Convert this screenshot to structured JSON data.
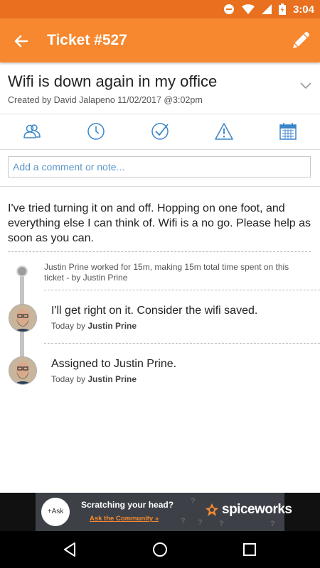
{
  "status_bar": {
    "time": "3:04",
    "icons": [
      "do-not-disturb-icon",
      "wifi-icon",
      "signal-icon",
      "battery-icon"
    ]
  },
  "app_bar": {
    "title": "Ticket #527",
    "back_icon": "back-arrow-icon",
    "edit_icon": "pencil-icon",
    "color": "#f7882f"
  },
  "ticket": {
    "title": "Wifi is down again in my office",
    "meta": "Created by David Jalapeno 11/02/2017 @3:02pm",
    "description": "I've tried turning it on and off. Hopping on one foot, and everything else I can think of. Wifi is a no go. Please help as soon as you can."
  },
  "actions": [
    "assignee-icon",
    "time-icon",
    "close-ticket-icon",
    "priority-icon",
    "due-date-icon"
  ],
  "comment": {
    "placeholder": "Add a comment or note..."
  },
  "timeline": {
    "log": "Justin Prine worked for 15m, making 15m total time spent on this ticket - by Justin Prine",
    "entries": [
      {
        "text": "I'll get right on it. Consider the wifi saved.",
        "meta_prefix": "Today by",
        "author": "Justin Prine"
      },
      {
        "text": "Assigned to Justin Prine.",
        "meta_prefix": "Today by",
        "author": "Justin Prine"
      }
    ]
  },
  "ad": {
    "ask_label": "+Ask",
    "headline": "Scratching your head?",
    "cta": "Ask the Community »",
    "brand": "spiceworks"
  },
  "nav": [
    "back-triangle-icon",
    "home-circle-icon",
    "recents-square-icon"
  ]
}
